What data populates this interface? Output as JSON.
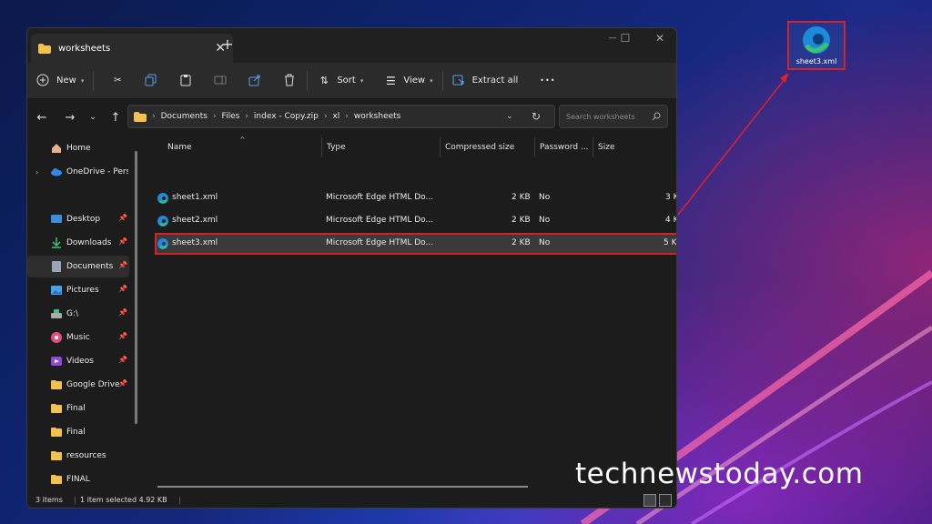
{
  "window": {
    "tab_title": "worksheets",
    "close": "✕",
    "new_tab": "+",
    "minimize": "—",
    "maximize": "☐",
    "close_window": "✕"
  },
  "toolbar": {
    "new": "New",
    "sort": "Sort",
    "view": "View",
    "extract": "Extract all",
    "more": "•••"
  },
  "address": {
    "path": [
      "Documents",
      "Files",
      "index - Copy.zip",
      "xl",
      "worksheets"
    ],
    "search_placeholder": "Search worksheets"
  },
  "sidebar": {
    "items": [
      {
        "label": "Home",
        "icon": "home-icon",
        "pinned": false
      },
      {
        "label": "OneDrive - Perso",
        "icon": "cloud-icon",
        "pinned": false
      },
      {
        "label": "Desktop",
        "icon": "desktop-icon",
        "pinned": true
      },
      {
        "label": "Downloads",
        "icon": "download-icon",
        "pinned": true
      },
      {
        "label": "Documents",
        "icon": "document-icon",
        "pinned": true
      },
      {
        "label": "Pictures",
        "icon": "picture-icon",
        "pinned": true
      },
      {
        "label": "G:\\",
        "icon": "drive-icon",
        "pinned": true
      },
      {
        "label": "Music",
        "icon": "music-icon",
        "pinned": true
      },
      {
        "label": "Videos",
        "icon": "video-icon",
        "pinned": true
      },
      {
        "label": "Google Drive",
        "icon": "folder-icon",
        "pinned": true
      },
      {
        "label": "Final",
        "icon": "folder-icon",
        "pinned": false
      },
      {
        "label": "Final",
        "icon": "folder-icon",
        "pinned": false
      },
      {
        "label": "resources",
        "icon": "folder-icon",
        "pinned": false
      },
      {
        "label": "FINAL",
        "icon": "folder-icon",
        "pinned": false
      }
    ]
  },
  "columns": {
    "name": "Name",
    "type": "Type",
    "compressed": "Compressed size",
    "password": "Password ...",
    "size": "Size"
  },
  "files": [
    {
      "name": "sheet1.xml",
      "type": "Microsoft Edge HTML Do...",
      "compressed": "2 KB",
      "password": "No",
      "size": "3 K"
    },
    {
      "name": "sheet2.xml",
      "type": "Microsoft Edge HTML Do...",
      "compressed": "2 KB",
      "password": "No",
      "size": "4 K"
    },
    {
      "name": "sheet3.xml",
      "type": "Microsoft Edge HTML Do...",
      "compressed": "2 KB",
      "password": "No",
      "size": "5 K"
    }
  ],
  "status": {
    "count": "3 items",
    "selected": "1 item selected  4.92 KB"
  },
  "desktop": {
    "icon_label": "sheet3.xml"
  },
  "watermark": "technewstoday.com",
  "colors": {
    "highlight": "#d8202a",
    "folder": "#f2c14e",
    "edge_blue": "#1b8ad8",
    "edge_green": "#3bc56b"
  }
}
